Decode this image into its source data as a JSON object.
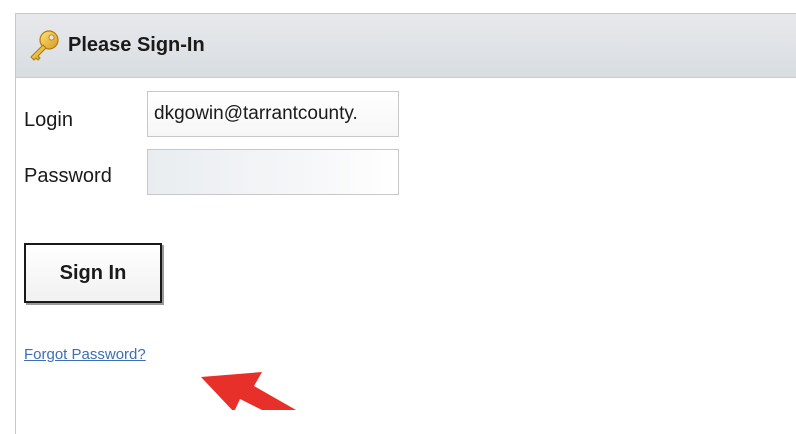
{
  "header": {
    "title": "Please Sign-In",
    "icon": "key-icon"
  },
  "form": {
    "login_label": "Login",
    "login_value": "dkgowin@tarrantcounty.",
    "password_label": "Password",
    "password_value": ""
  },
  "actions": {
    "signin_label": "Sign In",
    "forgot_label": "Forgot Password?"
  },
  "annotation": {
    "icon": "red-arrow-icon",
    "color": "#e8302a"
  },
  "colors": {
    "link": "#3b6fb6",
    "header_bg": "#dfe2e6"
  }
}
